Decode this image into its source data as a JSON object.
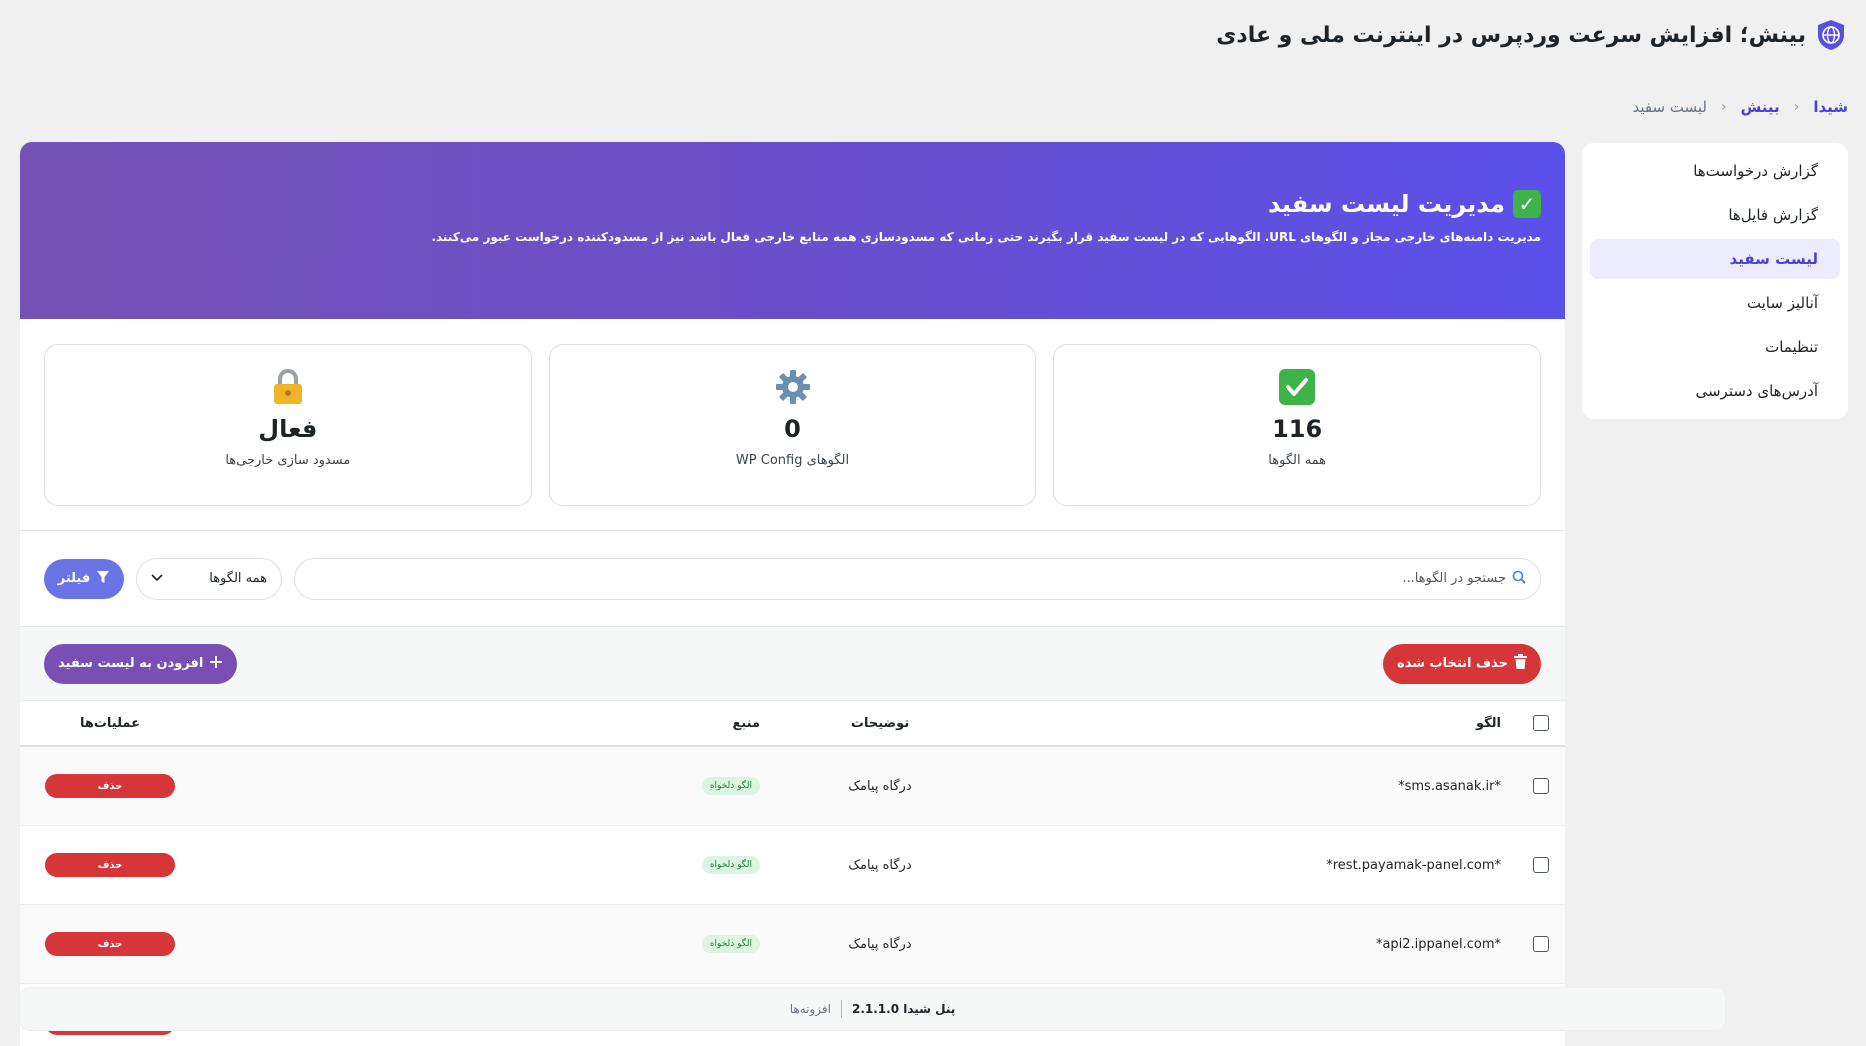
{
  "app": {
    "title": "بینش؛ افزایش سرعت وردپرس در اینترنت ملی و عادی"
  },
  "breadcrumb": {
    "root": "شیدا",
    "parent": "بینش",
    "current": "لیست سفید"
  },
  "sidebar": {
    "items": [
      {
        "label": "گزارش درخواست‌ها"
      },
      {
        "label": "گزارش فایل‌ها"
      },
      {
        "label": "لیست سفید"
      },
      {
        "label": "آنالیز سایت"
      },
      {
        "label": "تنظیمات"
      },
      {
        "label": "آدرس‌های دسترسی"
      }
    ]
  },
  "hero": {
    "title": "مدیریت لیست سفید",
    "description": "مدیریت دامنه‌های خارجی مجاز و الگوهای URL. الگوهایی که در لیست سفید قرار بگیرند حتی زمانی که مسدودسازی همه منابع خارجی فعال باشد نیز از مسدودکننده درخواست عبور می‌کنند."
  },
  "stats": [
    {
      "value": "116",
      "label": "همه الگوها",
      "icon": "check-icon"
    },
    {
      "value": "0",
      "label": "الگوهای WP Config",
      "icon": "gear-icon"
    },
    {
      "value": "فعال",
      "label": "مسدود سازی خارجی‌ها",
      "icon": "lock-icon"
    }
  ],
  "filters": {
    "search_placeholder": "جستجو در الگوها...",
    "select_value": "همه الگوها",
    "filter_button": "فیلتر"
  },
  "actions": {
    "delete_selected": "حذف انتخاب شده",
    "add_to_whitelist": "افزودن به لیست سفید"
  },
  "table": {
    "headers": {
      "pattern": "الگو",
      "description": "توضیحات",
      "source": "منبع",
      "operations": "عملیات‌ها"
    },
    "rows": [
      {
        "pattern": "*sms.asanak.ir*",
        "description": "درگاه پیامک",
        "source": "الگو دلخواه",
        "action": "حذف"
      },
      {
        "pattern": "*rest.payamak-panel.com*",
        "description": "درگاه پیامک",
        "source": "الگو دلخواه",
        "action": "حذف"
      },
      {
        "pattern": "*api2.ippanel.com*",
        "description": "درگاه پیامک",
        "source": "الگو دلخواه",
        "action": "حذف"
      }
    ]
  },
  "footer": {
    "plugins": "افزونه‌ها",
    "panel_name": "پنل شیدا 2.1.1.0"
  },
  "colors": {
    "accent": "#4b3fd6",
    "hero_start": "#5a50ea",
    "hero_end": "#7453b4",
    "danger": "#d63638",
    "add_button": "#7a4fb4",
    "filter_button": "#6b74e6"
  }
}
